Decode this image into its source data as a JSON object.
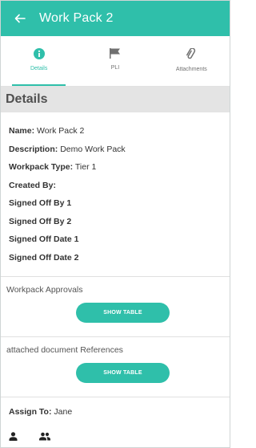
{
  "appbar": {
    "title": "Work Pack 2"
  },
  "tabs": [
    {
      "label": "Details",
      "icon": "info-icon",
      "active": true
    },
    {
      "label": "PLI",
      "icon": "flag-icon",
      "active": false
    },
    {
      "label": "Attachments",
      "icon": "paperclip-icon",
      "active": false
    }
  ],
  "details": {
    "header": "Details",
    "fields": [
      {
        "key": "Name:",
        "value": "Work Pack 2"
      },
      {
        "key": "Description:",
        "value": "Demo Work Pack"
      },
      {
        "key": "Workpack Type:",
        "value": "Tier 1"
      },
      {
        "key": "Created By:",
        "value": ""
      },
      {
        "key": "Signed Off By 1",
        "value": ""
      },
      {
        "key": "Signed Off By 2",
        "value": ""
      },
      {
        "key": "Signed Off Date 1",
        "value": ""
      },
      {
        "key": "Signed Off Date 2",
        "value": ""
      }
    ]
  },
  "approvals": {
    "title": "Workpack Approvals",
    "button": "SHOW TABLE"
  },
  "documents": {
    "title": "attached document References",
    "button": "SHOW TABLE"
  },
  "assign": {
    "key": "Assign To:",
    "value": "Jane"
  },
  "colors": {
    "accent": "#2fbfaa",
    "header_bg": "#e4e4e4"
  }
}
